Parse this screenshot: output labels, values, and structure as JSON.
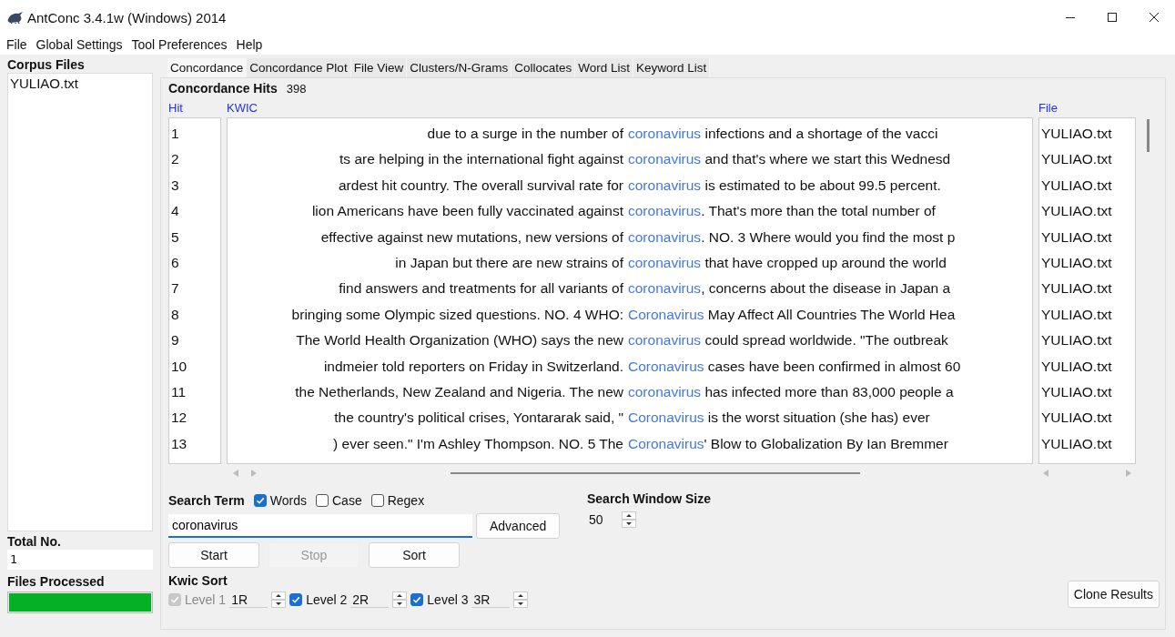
{
  "window": {
    "title": "AntConc 3.4.1w (Windows) 2014"
  },
  "menu": [
    "File",
    "Global Settings",
    "Tool Preferences",
    "Help"
  ],
  "corpus_files": {
    "label": "Corpus Files",
    "files": [
      {
        "name": "YULIAO.txt",
        "selected": false
      }
    ]
  },
  "total": {
    "label": "Total No.",
    "value": "1"
  },
  "files_processed": {
    "label": "Files Processed",
    "level": 1
  },
  "tabs": [
    {
      "label": "Concordance",
      "selected": true
    },
    {
      "label": "Concordance Plot",
      "selected": false
    },
    {
      "label": "File View",
      "selected": false
    },
    {
      "label": "Clusters/N-Grams",
      "selected": false
    },
    {
      "label": "Collocates",
      "selected": false
    },
    {
      "label": "Word List",
      "selected": false
    },
    {
      "label": "Keyword List",
      "selected": false
    }
  ],
  "hits": {
    "label": "Concordance Hits",
    "value": "398"
  },
  "table": {
    "columns": [
      "Hit",
      "KWIC",
      "File"
    ],
    "rows": [
      {
        "hit": "1",
        "left": "due to a surge in the number of",
        "keyword": "coronavirus",
        "right": " infections and a shortage of the vacci",
        "file": "YULIAO.txt"
      },
      {
        "hit": "2",
        "left": "ts are helping in the international fight against",
        "keyword": "coronavirus",
        "right": " and that's where we start this Wednesd",
        "file": "YULIAO.txt"
      },
      {
        "hit": "3",
        "left": "ardest hit country. The overall survival rate for",
        "keyword": "coronavirus",
        "right": " is estimated to be about 99.5 percent.",
        "file": "YULIAO.txt"
      },
      {
        "hit": "4",
        "left": "lion Americans have been fully vaccinated against",
        "keyword": "coronavirus",
        "right": ". That's more than the total number of",
        "file": "YULIAO.txt"
      },
      {
        "hit": "5",
        "left": "effective against new mutations, new versions of",
        "keyword": "coronavirus",
        "right": ". NO. 3 Where would you find the most p",
        "file": "YULIAO.txt"
      },
      {
        "hit": "6",
        "left": "in Japan but there are new strains of",
        "keyword": "coronavirus",
        "right": " that have cropped up around the world",
        "file": "YULIAO.txt"
      },
      {
        "hit": "7",
        "left": "find answers and treatments for all variants of",
        "keyword": "coronavirus",
        "right": ", concerns about the disease in Japan a",
        "file": "YULIAO.txt"
      },
      {
        "hit": "8",
        "left": "bringing some Olympic sized questions. NO. 4 WHO:",
        "keyword": "Coronavirus",
        "right": " May Affect All Countries The World Hea",
        "file": "YULIAO.txt"
      },
      {
        "hit": "9",
        "left": "The World Health Organization (WHO) says the new",
        "keyword": "coronavirus",
        "right": " could spread worldwide. \"The outbreak",
        "file": "YULIAO.txt"
      },
      {
        "hit": "10",
        "left": "indmeier told reporters on Friday in Switzerland.",
        "keyword": "Coronavirus",
        "right": " cases have been confirmed in almost 60",
        "file": "YULIAO.txt"
      },
      {
        "hit": "11",
        "left": "the Netherlands, New Zealand and Nigeria. The new",
        "keyword": "coronavirus",
        "right": " has infected more than 83,000 people a",
        "file": "YULIAO.txt"
      },
      {
        "hit": "12",
        "left": "the country's political crises, Yontararak said, \"",
        "keyword": "Coronavirus",
        "right": " is the worst situation (she has) ever",
        "file": "YULIAO.txt"
      },
      {
        "hit": "13",
        "left": ") ever seen.\" I'm Ashley Thompson. NO. 5 The",
        "keyword": "Coronavirus",
        "right": "' Blow to Globalization By Ian Bremmer",
        "file": "YULIAO.txt"
      }
    ]
  },
  "search": {
    "label": "Search Term",
    "options": [
      {
        "label": "Words",
        "checked": true
      },
      {
        "label": "Case",
        "checked": false
      },
      {
        "label": "Regex",
        "checked": false
      }
    ],
    "value": "coronavirus",
    "advanced": "Advanced"
  },
  "window_size": {
    "label": "Search Window Size",
    "value": "50"
  },
  "buttons": [
    {
      "label": "Start",
      "disabled": false
    },
    {
      "label": "Stop",
      "disabled": true
    },
    {
      "label": "Sort",
      "disabled": false
    }
  ],
  "kwic_sort": {
    "label": "Kwic Sort",
    "levels": [
      {
        "label": "Level 1",
        "checked": true,
        "disabled": true,
        "value": "1R"
      },
      {
        "label": "Level 2",
        "checked": true,
        "disabled": false,
        "value": "2R"
      },
      {
        "label": "Level 3",
        "checked": true,
        "disabled": false,
        "value": "3R"
      }
    ]
  },
  "clone": "Clone Results"
}
